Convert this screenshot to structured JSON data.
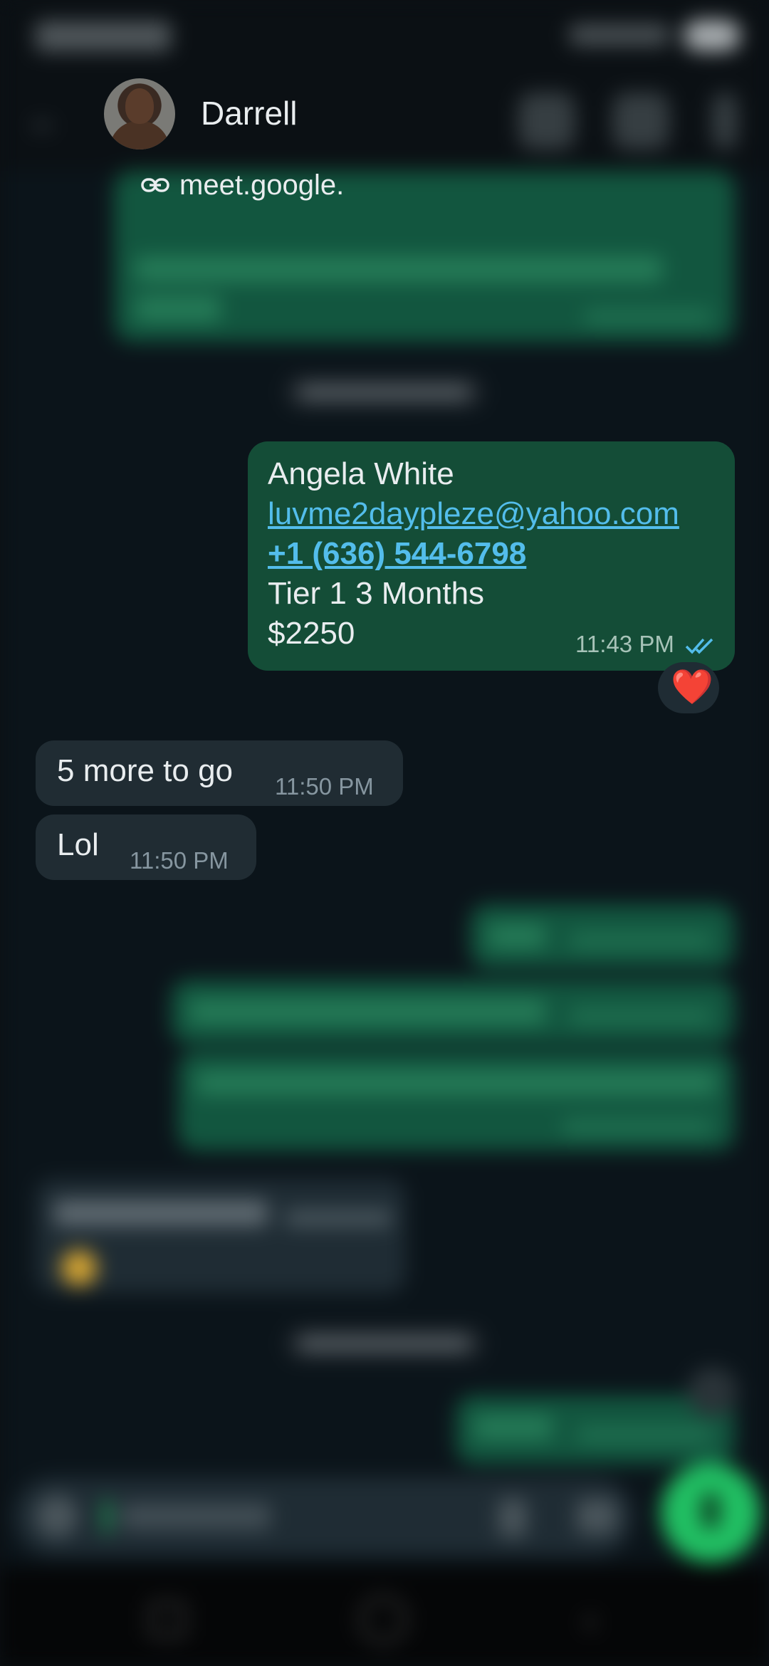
{
  "header": {
    "contact_name": "Darrell",
    "avatar": "contact-avatar-photo",
    "icons": [
      "back-arrow-icon",
      "video-call-icon",
      "phone-icon",
      "more-vert-icon"
    ]
  },
  "link_preview": {
    "icon": "link-icon",
    "text": "meet.google."
  },
  "highlighted_message": {
    "lines": {
      "name": "Angela White",
      "email": "luvme2daypleze@yahoo.com",
      "phone": "+1 (636) 544-6798",
      "plan": "Tier 1 3 Months",
      "amount": "$2250"
    },
    "time": "11:43 PM",
    "status_icon": "double-check-read-icon",
    "reaction": "❤️"
  },
  "incoming_messages": [
    {
      "text": "5 more to go",
      "time": "11:50 PM"
    },
    {
      "text": "Lol",
      "time": "11:50 PM"
    }
  ],
  "colors": {
    "background": "#0b141a",
    "outgoing_bubble": "#144d37",
    "incoming_bubble": "#202c33",
    "link": "#53bdeb",
    "mic_button": "#21c063"
  },
  "composer": {
    "icons": [
      "emoji-icon",
      "attach-icon",
      "camera-icon",
      "mic-icon"
    ]
  },
  "navbar": {
    "icons": [
      "recents-icon",
      "home-icon",
      "back-icon"
    ]
  }
}
